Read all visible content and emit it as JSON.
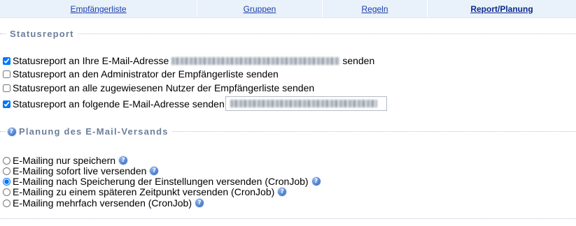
{
  "tabs": [
    {
      "label": "Empfängerliste"
    },
    {
      "label": "Gruppen"
    },
    {
      "label": "Regeln"
    },
    {
      "label": "Report/Planung"
    }
  ],
  "statusreport": {
    "legend": "Statusreport",
    "options": [
      {
        "label_before": "Statusreport an Ihre E-Mail-Adresse",
        "label_after": "senden",
        "checked": true
      },
      {
        "label": "Statusreport an den Administrator der Empfängerliste senden",
        "checked": false
      },
      {
        "label": "Statusreport an alle zugewiesenen Nutzer der Empfängerliste senden",
        "checked": false
      },
      {
        "label": "Statusreport an folgende E-Mail-Adresse senden",
        "checked": true
      }
    ]
  },
  "planung": {
    "legend": "Planung des E-Mail-Versands",
    "options": [
      {
        "label": "E-Mailing nur speichern",
        "checked": false
      },
      {
        "label": "E-Mailing sofort live versenden",
        "checked": false
      },
      {
        "label": "E-Mailing nach Speicherung der Einstellungen versenden (CronJob)",
        "checked": true
      },
      {
        "label": "E-Mailing zu einem späteren Zeitpunkt versenden (CronJob)",
        "checked": false
      },
      {
        "label": "E-Mailing mehrfach versenden (CronJob)",
        "checked": false
      }
    ]
  },
  "icons": {
    "help": "help-icon"
  },
  "colors": {
    "link": "#1a3ea8",
    "tab_bg": "#e9f1fb",
    "legend": "#6c7f9a",
    "help_icon": "#2c5fb8"
  }
}
